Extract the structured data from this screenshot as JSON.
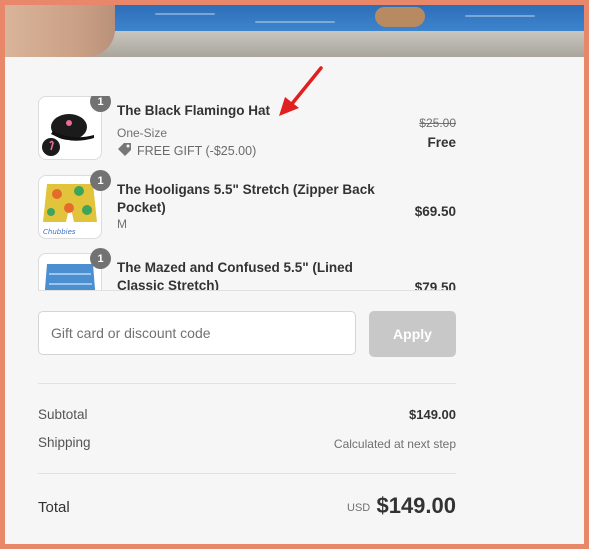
{
  "items": [
    {
      "qty": "1",
      "name": "The Black Flamingo Hat",
      "variant": "One-Size",
      "gift": "FREE GIFT (-$25.00)",
      "original_price": "$25.00",
      "price": "Free"
    },
    {
      "qty": "1",
      "name": "The Hooligans 5.5\" Stretch (Zipper Back Pocket)",
      "variant": "M",
      "price": "$69.50"
    },
    {
      "qty": "1",
      "name": "The Mazed and Confused 5.5\" (Lined Classic Stretch)",
      "price": "$79.50"
    }
  ],
  "discount": {
    "placeholder": "Gift card or discount code",
    "apply_label": "Apply"
  },
  "summary": {
    "subtotal_label": "Subtotal",
    "subtotal_value": "$149.00",
    "shipping_label": "Shipping",
    "shipping_value": "Calculated at next step",
    "total_label": "Total",
    "currency": "USD",
    "total_value": "$149.00"
  },
  "icons": [
    "tag-icon",
    "arrow-annotation-icon"
  ],
  "colors": {
    "frame_border": "#e8876a",
    "apply_disabled": "#c8c8c8",
    "annotation_arrow": "#e02020"
  }
}
